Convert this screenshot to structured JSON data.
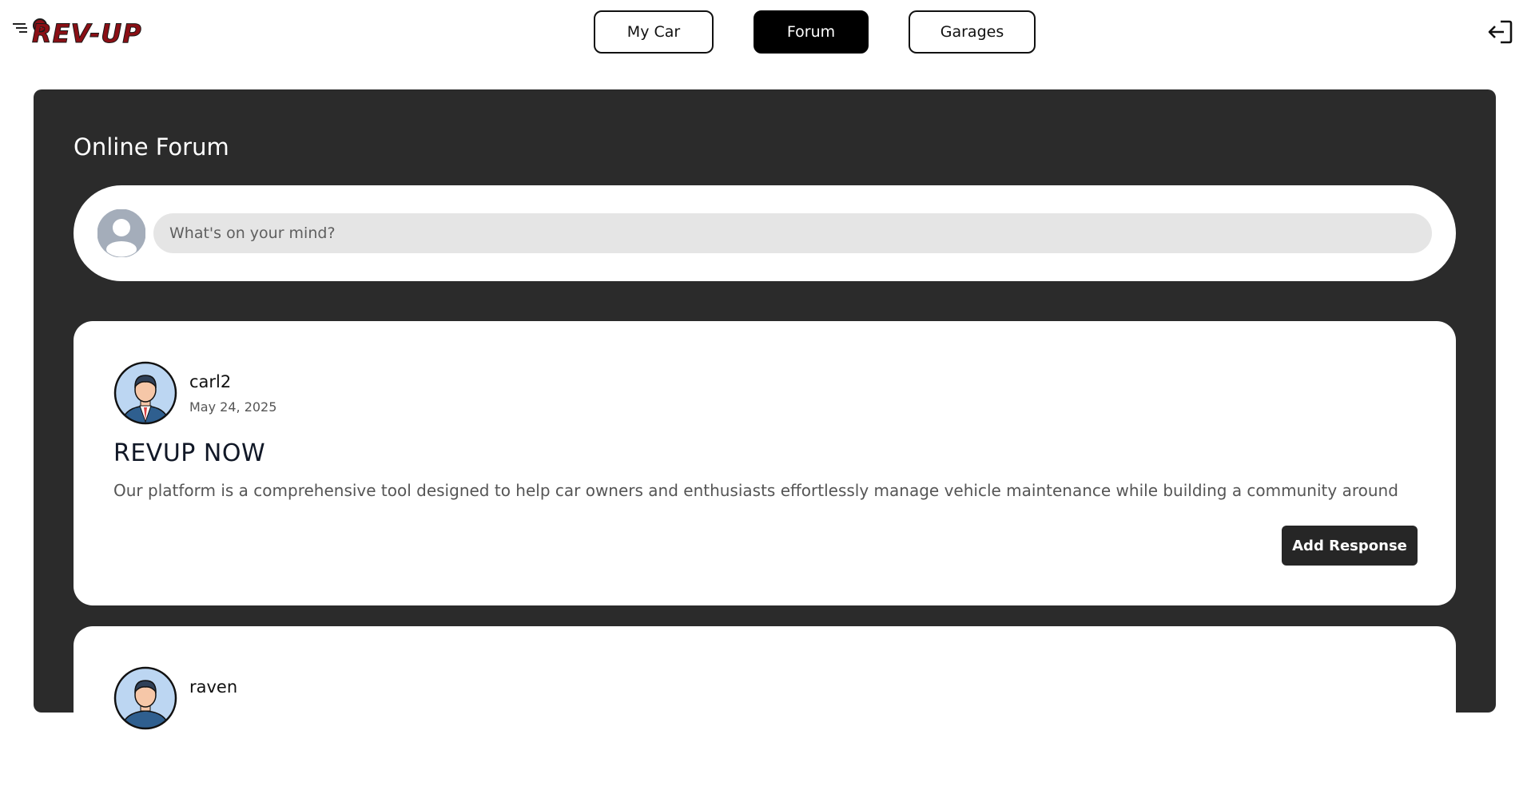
{
  "header": {
    "logo_text": "REV-UP",
    "nav": {
      "my_car": "My Car",
      "forum": "Forum",
      "garages": "Garages"
    },
    "logout_icon": "logout-icon"
  },
  "main": {
    "title": "Online Forum",
    "composer": {
      "placeholder": "What's on your mind?",
      "value": ""
    },
    "posts": [
      {
        "user": "carl2",
        "date": "May 24, 2025",
        "title": "REVUP NOW",
        "body": "Our platform is a comprehensive tool designed to help car owners and enthusiasts effortlessly manage vehicle maintenance while building a community around",
        "action": "Add Response"
      },
      {
        "user": "raven"
      }
    ]
  },
  "colors": {
    "brand_red": "#8b0f15",
    "panel_bg": "#2b2b2b",
    "active_nav": "#000000"
  }
}
